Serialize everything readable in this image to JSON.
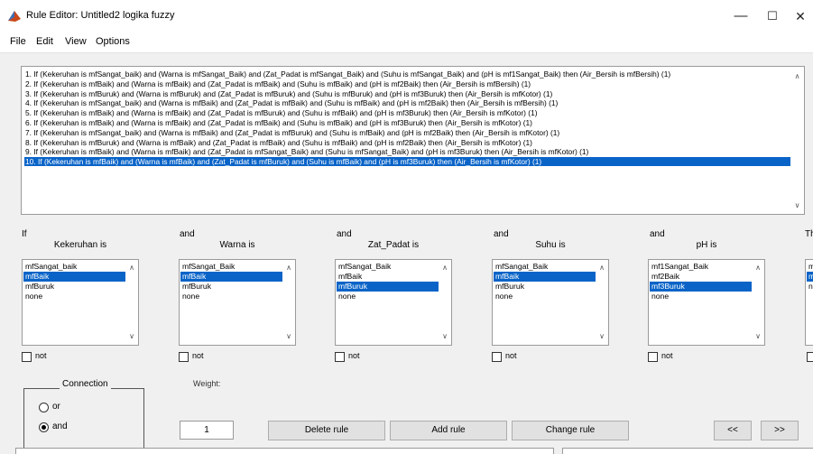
{
  "window": {
    "title": "Rule Editor: Untitled2 logika fuzzy",
    "minimize": "—",
    "maximize": "☐",
    "close": "✕"
  },
  "menu": [
    "File",
    "Edit",
    "View",
    "Options"
  ],
  "rules": [
    "1. If (Kekeruhan is mfSangat_baik) and (Warna is mfSangat_Baik) and (Zat_Padat is mfSangat_Baik) and (Suhu is mfSangat_Baik) and (pH is mf1Sangat_Baik) then (Air_Bersih is mfBersih) (1)",
    "2. If (Kekeruhan is mfBaik) and (Warna is mfBaik) and (Zat_Padat is mfBaik) and (Suhu is mfBaik) and (pH is mf2Baik) then (Air_Bersih is mfBersih) (1)",
    "3. If (Kekeruhan is mfBuruk) and (Warna is mfBuruk) and (Zat_Padat is mfBuruk) and (Suhu is mfBuruk) and (pH is mf3Buruk) then (Air_Bersih is mfKotor) (1)",
    "4. If (Kekeruhan is mfSangat_baik) and (Warna is mfBaik) and (Zat_Padat is mfBaik) and (Suhu is mfBaik) and (pH is mf2Baik) then (Air_Bersih is mfBersih) (1)",
    "5. If (Kekeruhan is mfBaik) and (Warna is mfBaik) and (Zat_Padat is mfBuruk) and (Suhu is mfBaik) and (pH is mf3Buruk) then (Air_Bersih is mfKotor) (1)",
    "6. If (Kekeruhan is mfBaik) and (Warna is mfBaik) and (Zat_Padat is mfBaik) and (Suhu is mfBaik) and (pH is mf3Buruk) then (Air_Bersih is mfKotor) (1)",
    "7. If (Kekeruhan is mfSangat_baik) and (Warna is mfBaik) and (Zat_Padat is mfBuruk) and (Suhu is mfBaik) and (pH is mf2Baik) then (Air_Bersih is mfKotor) (1)",
    "8. If (Kekeruhan is mfBuruk) and (Warna is mfBaik) and (Zat_Padat is mfBaik) and (Suhu is mfBaik) and (pH is mf2Baik) then (Air_Bersih is mfKotor) (1)",
    "9. If (Kekeruhan is mfBaik) and (Warna is mfBaik) and (Zat_Padat is mfSangat_Baik) and (Suhu is mfSangat_Baik) and (pH is mf3Buruk) then (Air_Bersih is mfKotor) (1)",
    "10. If (Kekeruhan is mfBaik) and (Warna is mfBaik) and (Zat_Padat is mfBuruk) and (Suhu is mfBaik) and (pH is mf3Buruk) then (Air_Bersih is mfKotor) (1)"
  ],
  "selected_rule": 9,
  "if_label": "If",
  "then_label": "Th",
  "and_label": "and",
  "variables": [
    {
      "label": "Kekeruhan is",
      "options": [
        "mfSangat_baik",
        "mfBaik",
        "mfBuruk",
        "none"
      ],
      "selected": 1
    },
    {
      "label": "Warna is",
      "options": [
        "mfSangat_Baik",
        "mfBaik",
        "mfBuruk",
        "none"
      ],
      "selected": 1
    },
    {
      "label": "Zat_Padat is",
      "options": [
        "mfSangat_Baik",
        "mfBaik",
        "mfBuruk",
        "none"
      ],
      "selected": 2
    },
    {
      "label": "Suhu is",
      "options": [
        "mfSangat_Baik",
        "mfBaik",
        "mfBuruk",
        "none"
      ],
      "selected": 1
    },
    {
      "label": "pH is",
      "options": [
        "mf1Sangat_Baik",
        "mf2Baik",
        "mf3Buruk",
        "none"
      ],
      "selected": 2
    }
  ],
  "output_partial": {
    "options": [
      "m",
      "m",
      "no"
    ],
    "selected": 1
  },
  "not_label": "not",
  "connection": {
    "title": "Connection",
    "or_label": "or",
    "and_label": "and",
    "selected": "and"
  },
  "weight": {
    "label": "Weight:",
    "value": "1"
  },
  "buttons": {
    "delete": "Delete rule",
    "add": "Add rule",
    "change": "Change rule",
    "prev": "<<",
    "next": ">>"
  },
  "colors": {
    "selection": "#0a64c8",
    "background": "#f0f0f0"
  }
}
